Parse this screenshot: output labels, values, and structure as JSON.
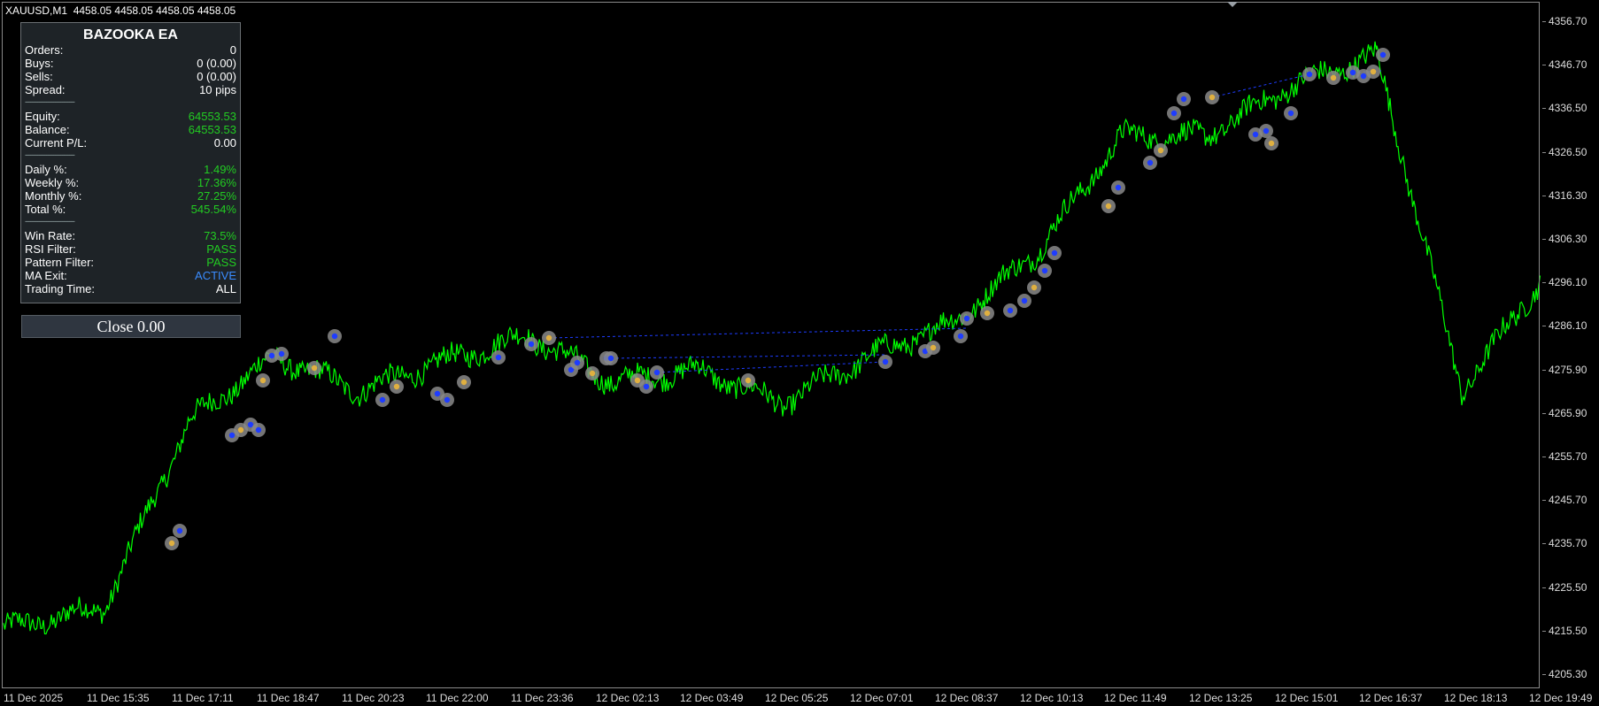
{
  "header": {
    "symbol": "XAUUSD,M1",
    "ohlc": "4458.05 4458.05 4458.05 4458.05"
  },
  "ea_panel": {
    "title": "BAZOOKA EA",
    "rows1": [
      {
        "label": "Orders:",
        "value": "0"
      },
      {
        "label": "Buys:",
        "value": "0 (0.00)"
      },
      {
        "label": "Sells:",
        "value": "0 (0.00)"
      },
      {
        "label": "Spread:",
        "value": "10 pips"
      }
    ],
    "rows2": [
      {
        "label": "Equity:",
        "value": "64553.53"
      },
      {
        "label": "Balance:",
        "value": "64553.53"
      },
      {
        "label": "Current P/L:",
        "value": "0.00"
      }
    ],
    "rows3": [
      {
        "label": "Daily %:",
        "value": "1.49%"
      },
      {
        "label": "Weekly %:",
        "value": "17.36%"
      },
      {
        "label": "Monthly %:",
        "value": "27.25%"
      },
      {
        "label": "Total %:",
        "value": "545.54%"
      }
    ],
    "rows4": [
      {
        "label": "Win Rate:",
        "value": "73.5%"
      },
      {
        "label": "RSI Filter:",
        "value": "PASS"
      },
      {
        "label": "Pattern Filter:",
        "value": "PASS"
      },
      {
        "label": "MA Exit:",
        "value": "ACTIVE"
      },
      {
        "label": "Trading Time:",
        "value": "ALL"
      }
    ],
    "separator": "----------------------------",
    "close_button": "Close 0.00"
  },
  "colors": {
    "background": "#000000",
    "price_line": "#00ff00",
    "trade_link": "#1e3cff",
    "value_green": "#22cc22",
    "value_blue": "#3a8cff",
    "marker_ring": "#8a8a8a",
    "panel_bg": "#1e2327"
  },
  "price_axis": {
    "labels": [
      "4356.70",
      "4346.70",
      "4336.50",
      "4326.50",
      "4316.30",
      "4306.30",
      "4296.10",
      "4286.10",
      "4275.90",
      "4265.90",
      "4255.70",
      "4245.70",
      "4235.70",
      "4225.50",
      "4215.50",
      "4205.30"
    ]
  },
  "time_axis": {
    "labels": [
      "11 Dec 2025",
      "11 Dec 15:35",
      "11 Dec 17:11",
      "11 Dec 18:47",
      "11 Dec 20:23",
      "11 Dec 22:00",
      "11 Dec 23:36",
      "12 Dec 02:13",
      "12 Dec 03:49",
      "12 Dec 05:25",
      "12 Dec 07:01",
      "12 Dec 08:37",
      "12 Dec 10:13",
      "12 Dec 11:49",
      "12 Dec 13:25",
      "12 Dec 15:01",
      "12 Dec 16:37",
      "12 Dec 18:13",
      "12 Dec 19:49"
    ]
  },
  "chart_data": {
    "type": "line",
    "title": "XAUUSD,M1",
    "xlabel": "",
    "ylabel": "",
    "ylim": [
      4200.0,
      4362.0
    ],
    "x": [
      "11 Dec 2025",
      "11 Dec 15:35",
      "11 Dec 17:11",
      "11 Dec 18:47",
      "11 Dec 20:23",
      "11 Dec 22:00",
      "11 Dec 23:36",
      "12 Dec 02:13",
      "12 Dec 03:49",
      "12 Dec 05:25",
      "12 Dec 07:01",
      "12 Dec 08:37",
      "12 Dec 10:13",
      "12 Dec 11:49",
      "12 Dec 13:25",
      "12 Dec 15:01",
      "12 Dec 16:37",
      "12 Dec 18:13",
      "12 Dec 19:49"
    ],
    "series": [
      {
        "values": [
          4214.0,
          4219.0,
          4263.0,
          4278.0,
          4270.0,
          4277.0,
          4283.0,
          4272.0,
          4275.0,
          4267.0,
          4278.0,
          4286.0,
          4303.0,
          4330.0,
          4330.0,
          4342.0,
          4349.0,
          4270.0,
          4296.0
        ]
      }
    ]
  }
}
